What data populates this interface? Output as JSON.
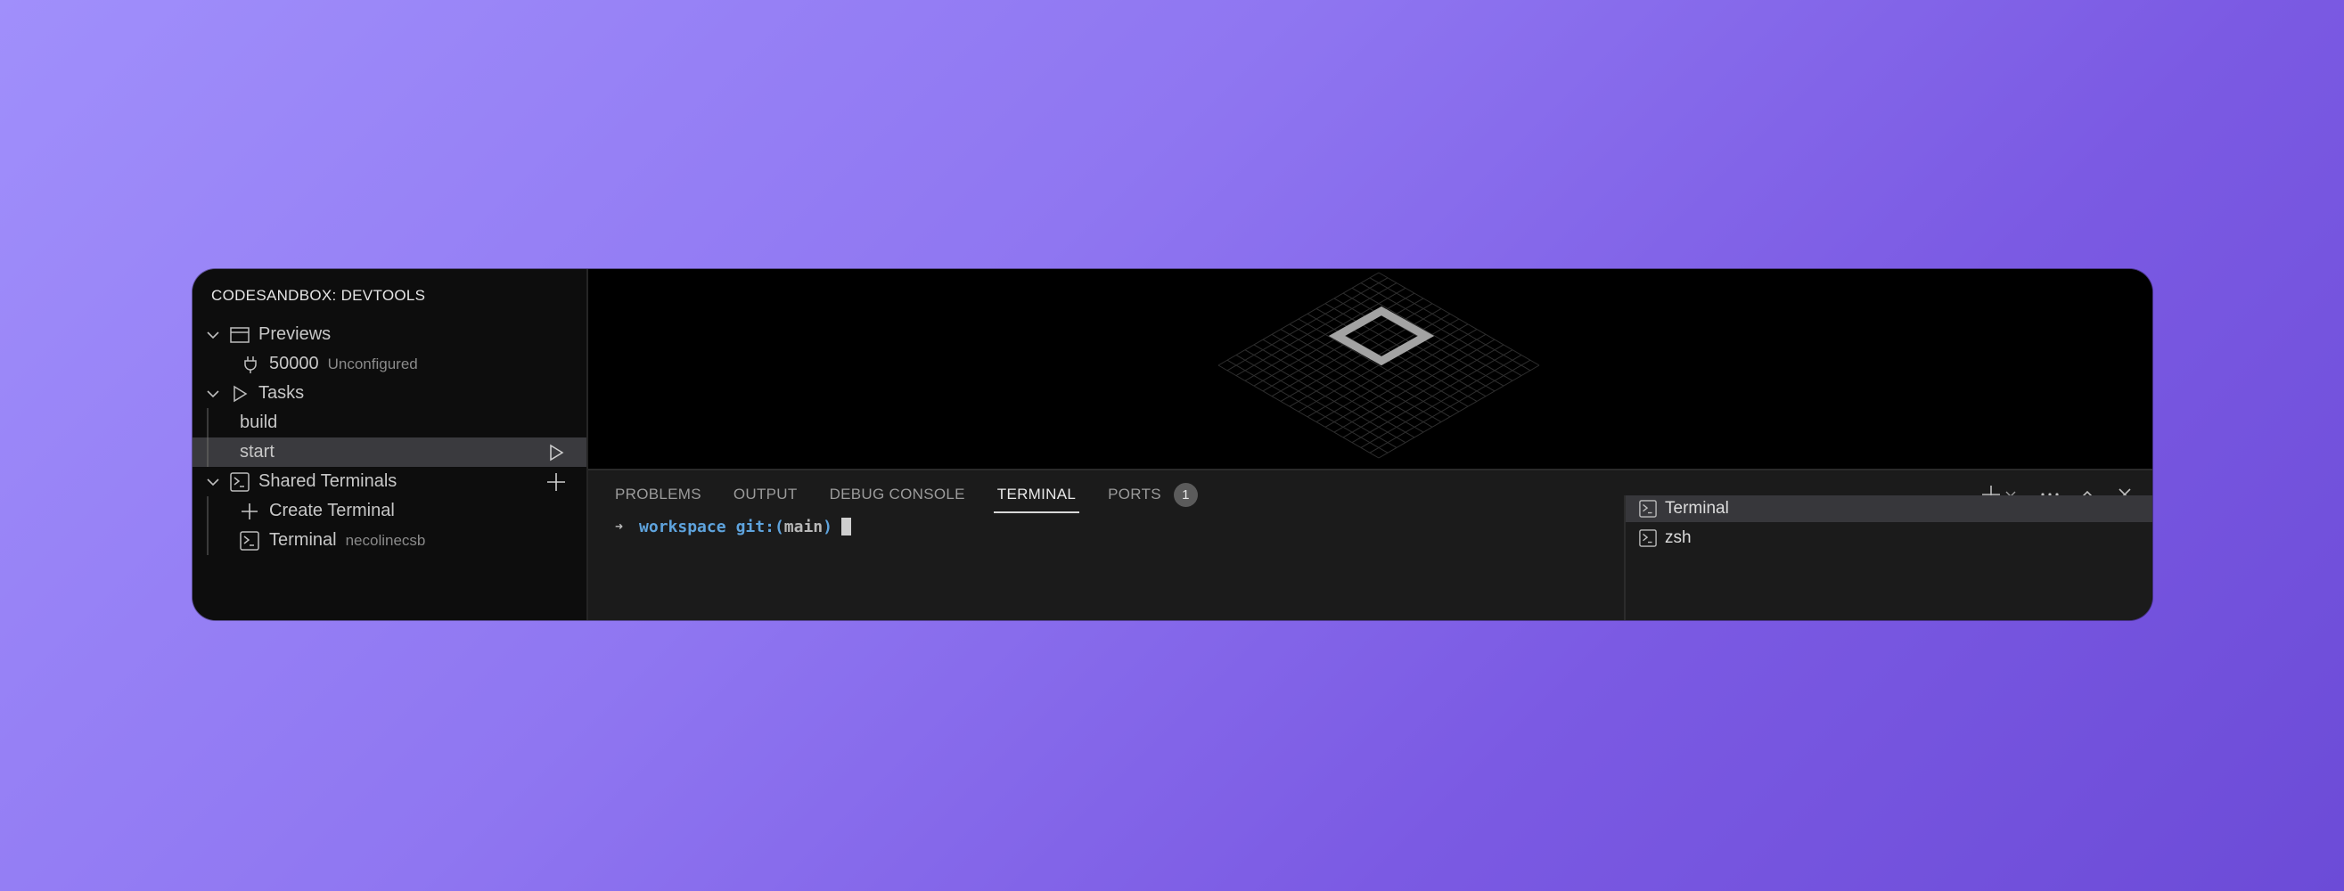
{
  "sidebar": {
    "title": "CODESANDBOX: DEVTOOLS",
    "sections": [
      {
        "label": "Previews",
        "icon": "browser-window-icon",
        "expanded": true,
        "items": [
          {
            "label": "50000",
            "sublabel": "Unconfigured",
            "icon": "plug-icon"
          }
        ]
      },
      {
        "label": "Tasks",
        "icon": "play-icon",
        "expanded": true,
        "items": [
          {
            "label": "build"
          },
          {
            "label": "start",
            "selected": true,
            "action_icon": "run-icon"
          }
        ]
      },
      {
        "label": "Shared Terminals",
        "icon": "terminal-icon",
        "expanded": true,
        "action_icon": "plus-icon",
        "items": [
          {
            "label": "Create Terminal",
            "icon": "plus-icon"
          },
          {
            "label": "Terminal",
            "sublabel": "necolinecsb",
            "icon": "terminal-icon"
          }
        ]
      }
    ]
  },
  "panel": {
    "tabs": [
      {
        "label": "PROBLEMS"
      },
      {
        "label": "OUTPUT"
      },
      {
        "label": "DEBUG CONSOLE"
      },
      {
        "label": "TERMINAL",
        "active": true
      },
      {
        "label": "PORTS",
        "badge": "1"
      }
    ],
    "tools": [
      "plus-icon",
      "chevron-down-icon",
      "more-icon",
      "chevron-up-icon",
      "close-icon"
    ],
    "terminal": {
      "arrow": "➜",
      "cwd": "workspace",
      "git_prefix": "git:",
      "paren_open": "(",
      "branch": "main",
      "paren_close": ")"
    },
    "terminal_list": [
      {
        "label": "Terminal",
        "selected": true
      },
      {
        "label": "zsh"
      }
    ]
  },
  "colors": {
    "accent_prompt": "#5ea3dd",
    "background_start": "#a08ffb",
    "background_end": "#6c4bd7"
  }
}
